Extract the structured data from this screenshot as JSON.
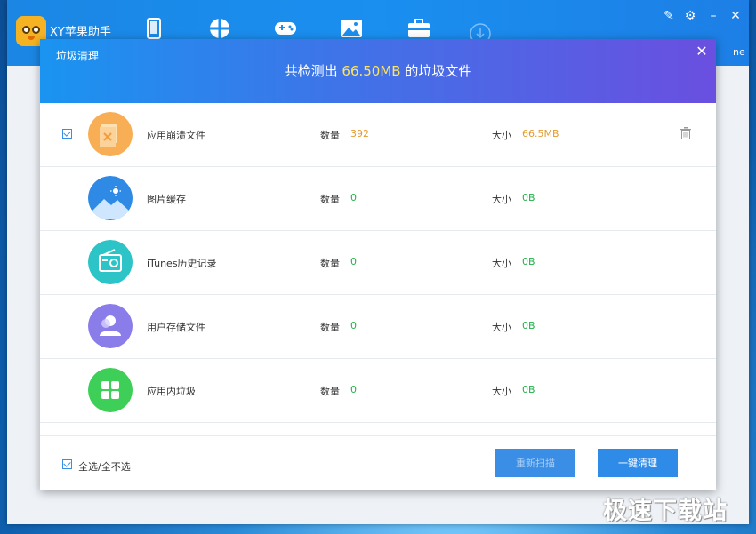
{
  "app": {
    "title": "XY苹果助手",
    "device_name_partial": "ne",
    "nav_icons": [
      "phone-icon",
      "apps-icon",
      "games-icon",
      "wallpaper-icon",
      "toolbox-icon",
      "download-icon"
    ],
    "window_controls": [
      "edit-icon",
      "settings-icon",
      "minimize-icon",
      "close-icon"
    ]
  },
  "dialog": {
    "title": "垃圾清理",
    "summary_prefix": "共检测出",
    "summary_size": "66.50MB",
    "summary_suffix": "的垃圾文件",
    "count_label": "数量",
    "size_label": "大小",
    "rows": [
      {
        "name": "应用崩溃文件",
        "count": "392",
        "size": "66.5MB",
        "checked": true,
        "icon": "crash-file-icon",
        "color": "#f7a54a"
      },
      {
        "name": "图片缓存",
        "count": "0",
        "size": "0B",
        "checked": false,
        "icon": "image-cache-icon",
        "color": "#3a8ee6"
      },
      {
        "name": "iTunes历史记录",
        "count": "0",
        "size": "0B",
        "checked": false,
        "icon": "itunes-history-icon",
        "color": "#2fc3c6"
      },
      {
        "name": "用户存储文件",
        "count": "0",
        "size": "0B",
        "checked": false,
        "icon": "user-storage-icon",
        "color": "#8a7be8"
      },
      {
        "name": "应用内垃圾",
        "count": "0",
        "size": "0B",
        "checked": false,
        "icon": "in-app-junk-icon",
        "color": "#3fcf5a"
      }
    ],
    "select_all_label": "全选/全不选",
    "buttons": {
      "secondary": "重新扫描",
      "primary": "一键清理"
    }
  },
  "watermark": "极速下载站"
}
